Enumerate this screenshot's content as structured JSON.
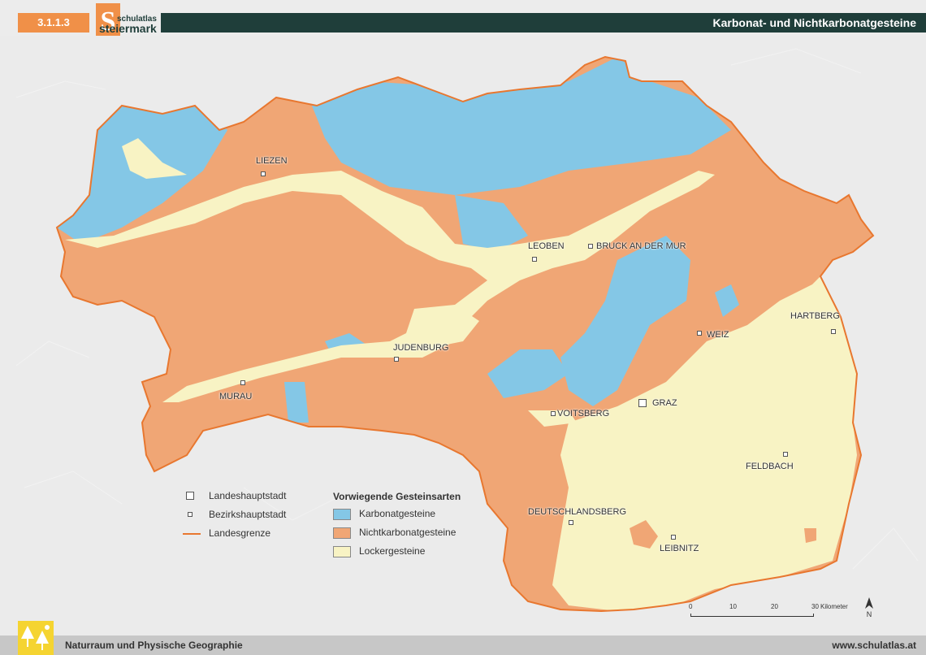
{
  "header": {
    "code": "3.1.1.3",
    "logo_top": "schulatlas",
    "logo_bottom": "steiermark",
    "title": "Karbonat- und Nichtkarbonatgesteine"
  },
  "colors": {
    "karbonat": "#84c7e6",
    "nichtkarbonat": "#f0a675",
    "locker": "#f8f3c4",
    "border": "#e8772f",
    "header_orange": "#f09048",
    "header_dark": "#1f3e3a"
  },
  "cities": [
    {
      "name": "LIEZEN",
      "type": "bezirk"
    },
    {
      "name": "LEOBEN",
      "type": "bezirk"
    },
    {
      "name": "BRUCK AN DER MUR",
      "type": "bezirk"
    },
    {
      "name": "HARTBERG",
      "type": "bezirk"
    },
    {
      "name": "WEIZ",
      "type": "bezirk"
    },
    {
      "name": "JUDENBURG",
      "type": "bezirk"
    },
    {
      "name": "MURAU",
      "type": "bezirk"
    },
    {
      "name": "VOITSBERG",
      "type": "bezirk"
    },
    {
      "name": "GRAZ",
      "type": "landeshaupt"
    },
    {
      "name": "FELDBACH",
      "type": "bezirk"
    },
    {
      "name": "DEUTSCHLANDSBERG",
      "type": "bezirk"
    },
    {
      "name": "LEIBNITZ",
      "type": "bezirk"
    }
  ],
  "legend": {
    "symbols": [
      {
        "label": "Landeshauptstadt"
      },
      {
        "label": "Bezirkshauptstadt"
      },
      {
        "label": "Landesgrenze"
      }
    ],
    "title": "Vorwiegende Gesteinsarten",
    "categories": [
      {
        "label": "Karbonatgesteine",
        "color": "#84c7e6"
      },
      {
        "label": "Nichtkarbonatgesteine",
        "color": "#f0a675"
      },
      {
        "label": "Lockergesteine",
        "color": "#f8f3c4"
      }
    ]
  },
  "scale": {
    "ticks": [
      "0",
      "10",
      "20",
      "30"
    ],
    "unit": "Kilometer"
  },
  "north": "N",
  "footer": {
    "left": "Naturraum und Physische Geographie",
    "right": "www.schulatlas.at"
  }
}
